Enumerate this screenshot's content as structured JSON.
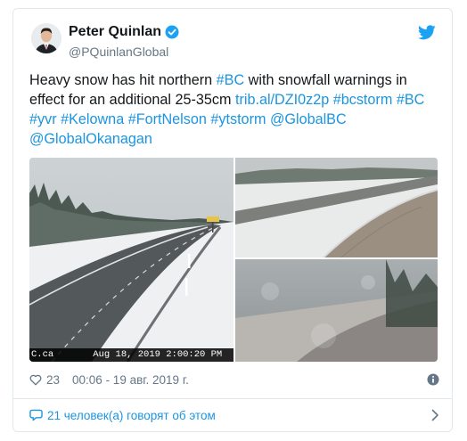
{
  "tweet": {
    "author_name": "Peter Quinlan",
    "author_handle": "@PQuinlanGlobal",
    "text_segments": [
      {
        "text": "Heavy snow has hit northern ",
        "link": false
      },
      {
        "text": "#BC",
        "link": true
      },
      {
        "text": " with snowfall warnings in effect for an additional 25-35cm ",
        "link": false
      },
      {
        "text": "trib.al/DZI0z2p",
        "link": true
      },
      {
        "text": " ",
        "link": false
      },
      {
        "text": "#bcstorm",
        "link": true
      },
      {
        "text": " ",
        "link": false
      },
      {
        "text": "#BC",
        "link": true
      },
      {
        "text": " ",
        "link": false
      },
      {
        "text": "#yvr",
        "link": true
      },
      {
        "text": " ",
        "link": false
      },
      {
        "text": "#Kelowna",
        "link": true
      },
      {
        "text": " ",
        "link": false
      },
      {
        "text": "#FortNelson",
        "link": true
      },
      {
        "text": " ",
        "link": false
      },
      {
        "text": "#ytstorm",
        "link": true
      },
      {
        "text": " ",
        "link": false
      },
      {
        "text": "@GlobalBC",
        "link": true
      },
      {
        "text": " ",
        "link": false
      },
      {
        "text": "@GlobalOkanagan",
        "link": true
      }
    ],
    "camera_stamp": "C.ca       Aug 18, 2019 2:00:20 PM",
    "likes": "23",
    "timestamp": "00:06 - 19 авг. 2019 г.",
    "conversation_label": "21 человек(а) говорят об этом"
  },
  "colors": {
    "link": "#1b95e0",
    "secondary_text": "#657786",
    "border": "#e1e8ed",
    "verified": "#1da1f2"
  },
  "icons": {
    "verified": "verified-badge-icon",
    "brand": "twitter-bird-icon",
    "like": "heart-icon",
    "info": "info-icon",
    "conversation": "speech-bubble-icon",
    "more": "chevron-right-icon"
  }
}
